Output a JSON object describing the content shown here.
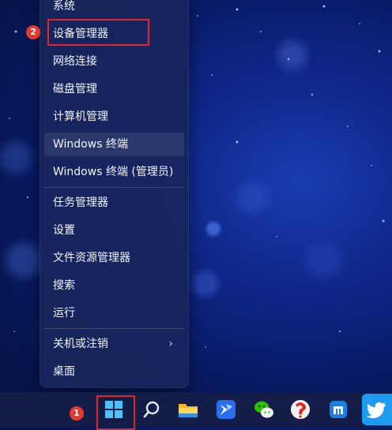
{
  "context_menu": {
    "items": [
      {
        "label": "系统"
      },
      {
        "label": "设备管理器"
      },
      {
        "label": "网络连接"
      },
      {
        "label": "磁盘管理"
      },
      {
        "label": "计算机管理"
      },
      {
        "label": "Windows 终端"
      },
      {
        "label": "Windows 终端 (管理员)"
      },
      {
        "label": "任务管理器"
      },
      {
        "label": "设置"
      },
      {
        "label": "文件资源管理器"
      },
      {
        "label": "搜索"
      },
      {
        "label": "运行"
      },
      {
        "label": "关机或注销"
      },
      {
        "label": "桌面"
      }
    ],
    "submenu_arrow": "›"
  },
  "annotations": {
    "step1": "1",
    "step2": "2",
    "highlight_color": "#e0262c"
  },
  "taskbar": {
    "icons": [
      "windows-start-icon",
      "search-icon",
      "file-explorer-icon",
      "feishu-icon",
      "wechat-icon",
      "app-icon",
      "maxthon-icon",
      "twitter-icon"
    ]
  }
}
